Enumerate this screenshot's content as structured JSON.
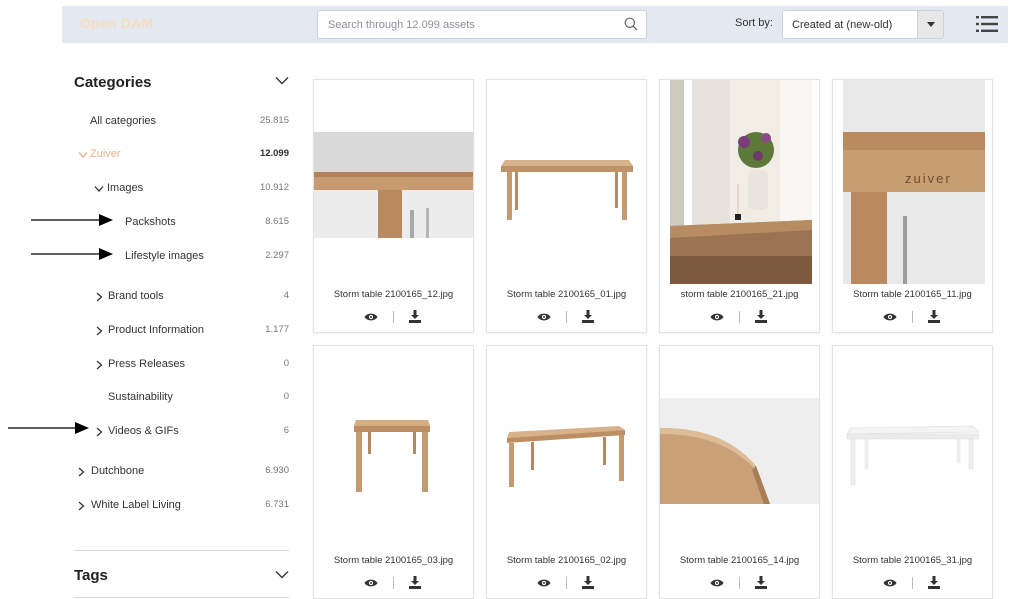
{
  "header": {
    "brand": "Open DAM",
    "search_placeholder": "Search through 12.099 assets",
    "sort_label": "Sort by:",
    "sort_value": "Created at (new-old)"
  },
  "categories": {
    "title": "Categories",
    "items": [
      {
        "label": "All categories",
        "count": "25.815"
      },
      {
        "label": "Zuiver",
        "count": "12.099"
      },
      {
        "label": "Images",
        "count": "10.912"
      },
      {
        "label": "Packshots",
        "count": "8.615"
      },
      {
        "label": "Lifestyle images",
        "count": "2.297"
      },
      {
        "label": "Brand tools",
        "count": "4"
      },
      {
        "label": "Product Information",
        "count": "1.177"
      },
      {
        "label": "Press Releases",
        "count": "0"
      },
      {
        "label": "Sustainability",
        "count": "0"
      },
      {
        "label": "Videos & GIFs",
        "count": "6"
      },
      {
        "label": "Dutchbone",
        "count": "6.930"
      },
      {
        "label": "White Label Living",
        "count": "6.731"
      }
    ]
  },
  "tags": {
    "title": "Tags"
  },
  "assets": [
    {
      "filename": "Storm table 2100165_12.jpg"
    },
    {
      "filename": "Storm table 2100165_01.jpg"
    },
    {
      "filename": "storm table 2100165_21.jpg"
    },
    {
      "filename": "Storm table 2100165_11.jpg"
    },
    {
      "filename": "Storm table 2100165_03.jpg"
    },
    {
      "filename": "Storm table 2100165_02.jpg"
    },
    {
      "filename": "Storm table 2100165_14.jpg"
    },
    {
      "filename": "Storm table 2100165_31.jpg"
    }
  ],
  "thumb_11_logo": "zuiver",
  "colors": {
    "accent": "#e8ae8a",
    "topbar": "#e4e9f1",
    "wood": "#c9a27a"
  }
}
